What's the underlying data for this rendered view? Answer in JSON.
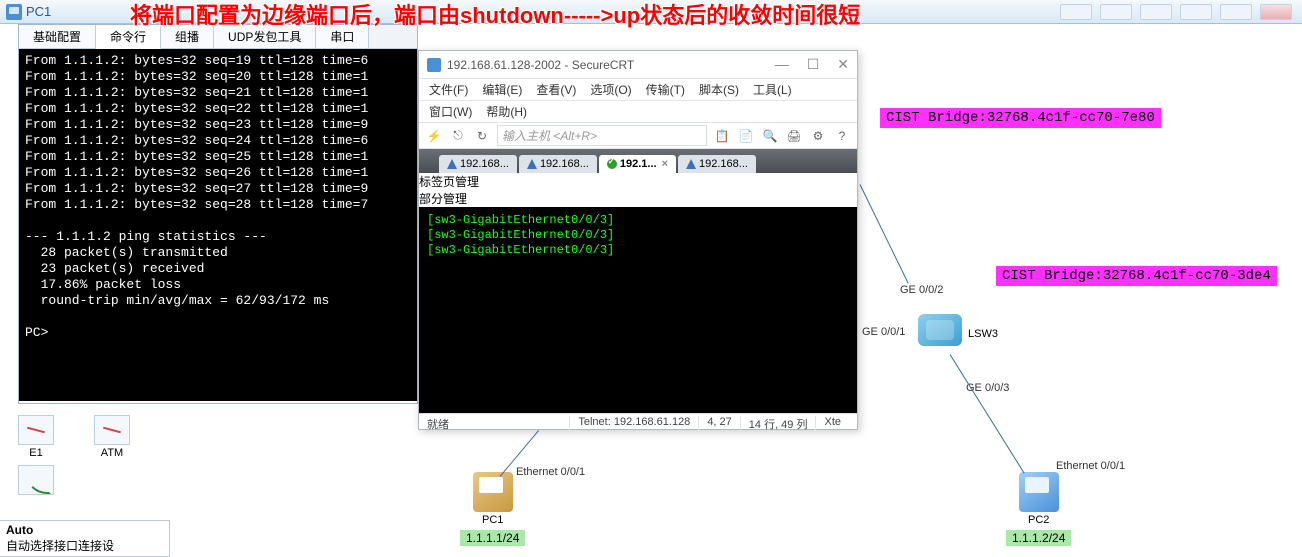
{
  "pc1_title": "PC1",
  "annotation": "将端口配置为边缘端口后，端口由shutdown----->up状态后的收敛时间很短",
  "tabs": [
    "基础配置",
    "命令行",
    "组播",
    "UDP发包工具",
    "串口"
  ],
  "terminal_lines": [
    "From 1.1.1.2: bytes=32 seq=19 ttl=128 time=6",
    "From 1.1.1.2: bytes=32 seq=20 ttl=128 time=1",
    "From 1.1.1.2: bytes=32 seq=21 ttl=128 time=1",
    "From 1.1.1.2: bytes=32 seq=22 ttl=128 time=1",
    "From 1.1.1.2: bytes=32 seq=23 ttl=128 time=9",
    "From 1.1.1.2: bytes=32 seq=24 ttl=128 time=6",
    "From 1.1.1.2: bytes=32 seq=25 ttl=128 time=1",
    "From 1.1.1.2: bytes=32 seq=26 ttl=128 time=1",
    "From 1.1.1.2: bytes=32 seq=27 ttl=128 time=9",
    "From 1.1.1.2: bytes=32 seq=28 ttl=128 time=7",
    "",
    "--- 1.1.1.2 ping statistics ---",
    "  28 packet(s) transmitted",
    "  23 packet(s) received",
    "  17.86% packet loss",
    "  round-trip min/avg/max = 62/93/172 ms",
    "",
    "PC>"
  ],
  "palette": {
    "e1": "E1",
    "atm": "ATM"
  },
  "auto": {
    "title": "Auto",
    "desc": "自动选择接口连接设"
  },
  "scrt": {
    "title": "192.168.61.128-2002 - SecureCRT",
    "menus": [
      "文件(F)",
      "编辑(E)",
      "查看(V)",
      "选项(O)",
      "传输(T)",
      "脚本(S)",
      "工具(L)"
    ],
    "menus2": [
      "窗口(W)",
      "帮助(H)"
    ],
    "addr_placeholder": "输入主机 <Alt+R>",
    "vtab1": "标签页管理",
    "vtab2": "部分管理",
    "tabs": [
      "192.168...",
      "192.168...",
      "192.1...",
      "192.168..."
    ],
    "term_lines": [
      "[sw3-GigabitEthernet0/0/3]",
      "[sw3-GigabitEthernet0/0/3]",
      "[sw3-GigabitEthernet0/0/3]"
    ],
    "status": {
      "ready": "就绪",
      "conn": "Telnet: 192.168.61.128",
      "pos1": "4, 27",
      "pos2": "14 行, 49 列",
      "enc": "Xte"
    }
  },
  "topo": {
    "bridge1": "CIST Bridge:32768.4c1f-cc70-7e80",
    "bridge2": "CIST Bridge:32768.4c1f-cc70-3de4",
    "lsw3": "LSW3",
    "ge002": "GE 0/0/2",
    "ge001": "GE 0/0/1",
    "ge003": "GE 0/0/3",
    "eth001a": "Ethernet 0/0/1",
    "eth001b": "Ethernet 0/0/1",
    "pc1": "PC1",
    "pc2": "PC2",
    "ip1": "1.1.1.1/24",
    "ip2": "1.1.1.2/24"
  }
}
